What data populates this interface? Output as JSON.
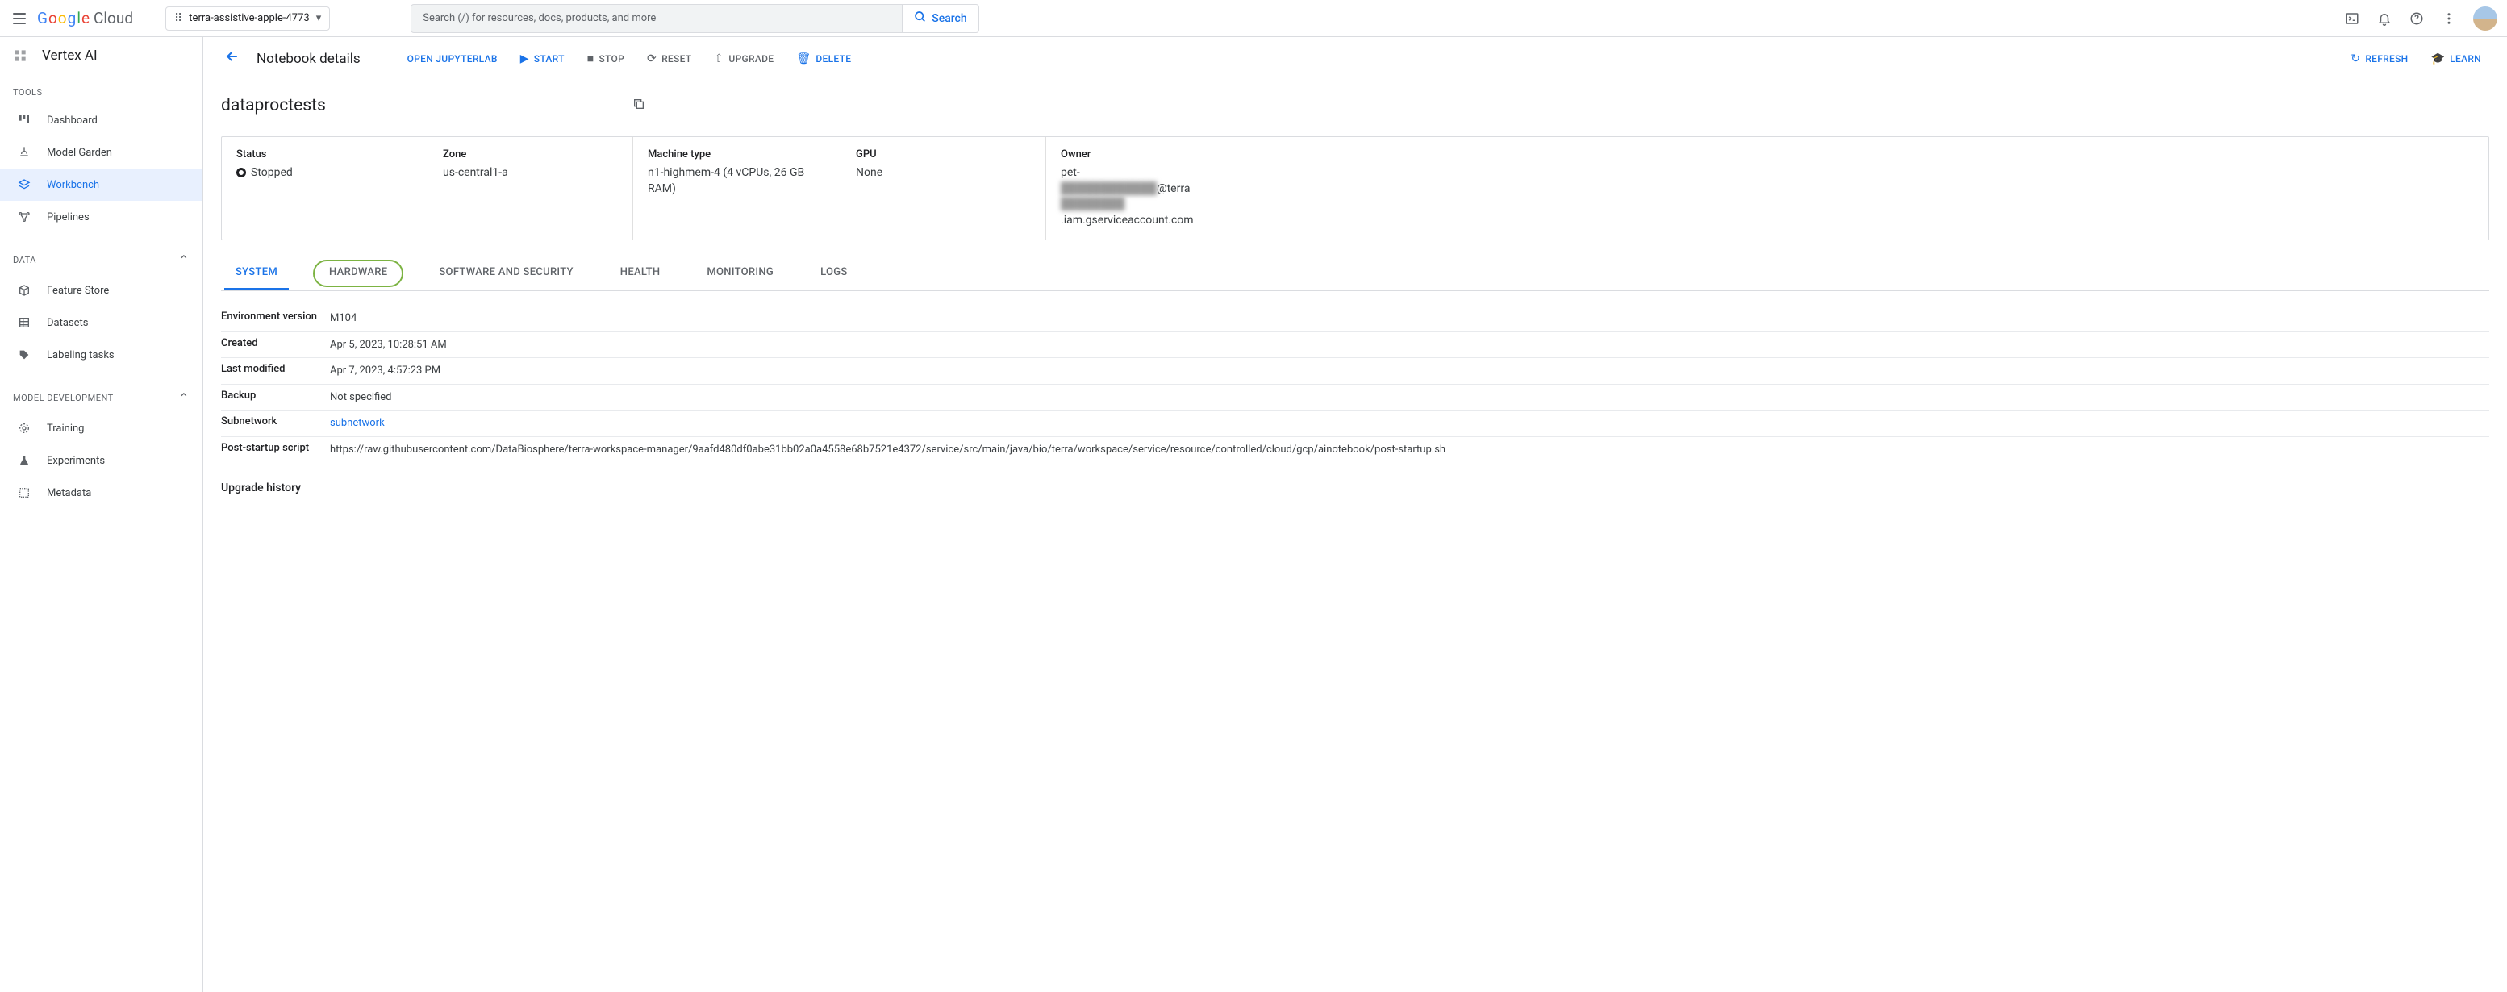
{
  "topbar": {
    "logo_cloud": "Cloud",
    "project_name": "terra-assistive-apple-4773",
    "search_placeholder": "Search (/) for resources, docs, products, and more",
    "search_btn": "Search"
  },
  "sidebar": {
    "product": "Vertex AI",
    "tools_label": "TOOLS",
    "data_label": "DATA",
    "model_dev_label": "MODEL DEVELOPMENT",
    "items": {
      "dashboard": "Dashboard",
      "model_garden": "Model Garden",
      "workbench": "Workbench",
      "pipelines": "Pipelines",
      "feature_store": "Feature Store",
      "datasets": "Datasets",
      "labeling": "Labeling tasks",
      "training": "Training",
      "experiments": "Experiments",
      "metadata": "Metadata"
    }
  },
  "actionbar": {
    "title": "Notebook details",
    "open_jupyter": "OPEN JUPYTERLAB",
    "start": "START",
    "stop": "STOP",
    "reset": "RESET",
    "upgrade": "UPGRADE",
    "delete": "DELETE",
    "refresh": "REFRESH",
    "learn": "LEARN"
  },
  "notebook": {
    "name": "dataproctests"
  },
  "info": {
    "status_label": "Status",
    "status_val": "Stopped",
    "zone_label": "Zone",
    "zone_val": "us-central1-a",
    "machine_label": "Machine type",
    "machine_val": "n1-highmem-4 (4 vCPUs, 26 GB RAM)",
    "gpu_label": "GPU",
    "gpu_val": "None",
    "owner_label": "Owner",
    "owner_pre": "pet-",
    "owner_mid1": "████████████",
    "owner_at": "@terra",
    "owner_mid2": "████████",
    "owner_suf": ".iam.gserviceaccount.com"
  },
  "tabs": {
    "system": "SYSTEM",
    "hardware": "HARDWARE",
    "software": "SOFTWARE AND SECURITY",
    "health": "HEALTH",
    "monitoring": "MONITORING",
    "logs": "LOGS"
  },
  "system_table": {
    "env_version_k": "Environment version",
    "env_version_v": "M104",
    "created_k": "Created",
    "created_v": "Apr 5, 2023, 10:28:51 AM",
    "modified_k": "Last modified",
    "modified_v": "Apr 7, 2023, 4:57:23 PM",
    "backup_k": "Backup",
    "backup_v": "Not specified",
    "subnet_k": "Subnetwork",
    "subnet_v": "subnetwork",
    "post_k": "Post-startup script",
    "post_v": "https://raw.githubusercontent.com/DataBiosphere/terra-workspace-manager/9aafd480df0abe31bb02a0a4558e68b7521e4372/service/src/main/java/bio/terra/workspace/service/resource/controlled/cloud/gcp/ainotebook/post-startup.sh"
  },
  "upgrade_history": "Upgrade history"
}
